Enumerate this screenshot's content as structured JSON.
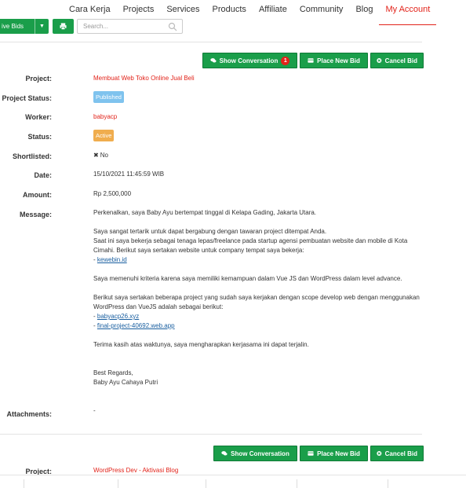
{
  "nav": {
    "items": [
      "Cara Kerja",
      "Projects",
      "Services",
      "Products",
      "Affiliate",
      "Community",
      "Blog",
      "My Account"
    ],
    "active": "My Account"
  },
  "toolbar": {
    "bid_toggle_label": "ive Bids",
    "search_placeholder": "Search..."
  },
  "bid1": {
    "buttons": {
      "show_conversation": "Show Conversation",
      "conversation_count": "1",
      "place_new_bid": "Place New Bid",
      "cancel_bid": "Cancel Bid"
    },
    "labels": {
      "project": "Project:",
      "project_status": "Project Status:",
      "worker": "Worker:",
      "status": "Status:",
      "shortlisted": "Shortlisted:",
      "date": "Date:",
      "amount": "Amount:",
      "message": "Message:",
      "attachments": "Attachments:"
    },
    "project": "Membuat Web Toko Online Jual Beli",
    "project_status": "Published",
    "worker": "babyacp",
    "status": "Active",
    "shortlisted": "No",
    "date": "15/10/2021 11:45:59 WIB",
    "amount": "Rp 2,500,000",
    "message": {
      "p1": "Perkenalkan, saya Baby Ayu bertempat tinggal di Kelapa Gading, Jakarta Utara.",
      "p2a": "Saya sangat tertarik untuk dapat bergabung dengan tawaran project ditempat Anda.",
      "p2b": "Saat ini saya bekerja sebagai tenaga lepas/freelance pada startup agensi pembuatan website dan mobile di Kota Cimahi. Berikut saya sertakan website untuk company tempat saya bekerja:",
      "link1_prefix": "- ",
      "link1": "kewebin.id",
      "p3": "Saya memenuhi kriteria karena saya memiliki kemampuan dalam  Vue JS dan WordPress dalam level advance.",
      "p4": "Berikut saya sertakan beberapa project yang sudah saya kerjakan dengan scope develop web dengan menggunakan WordPress dan VueJS adalah sebagai berikut:",
      "link2_prefix": "- ",
      "link2": "babyacp26.xyz",
      "link3_prefix": "- ",
      "link3": "final-project-40692.web.app",
      "p5": "Terima kasih atas waktunya, saya mengharapkan kerjasama ini dapat terjalin.",
      "sig1": "Best Regards,",
      "sig2": "Baby Ayu Cahaya Putri"
    },
    "attachments": "-"
  },
  "bid2": {
    "buttons": {
      "show_conversation": "Show Conversation",
      "place_new_bid": "Place New Bid",
      "cancel_bid": "Cancel Bid"
    },
    "labels": {
      "project": "Project:"
    },
    "project": "WordPress Dev - Aktivasi Blog"
  },
  "colors": {
    "primary_green": "#1a9e4a",
    "accent_red": "#e2231a",
    "published_blue": "#7fc3ee",
    "active_yellow": "#f0ad4e"
  }
}
